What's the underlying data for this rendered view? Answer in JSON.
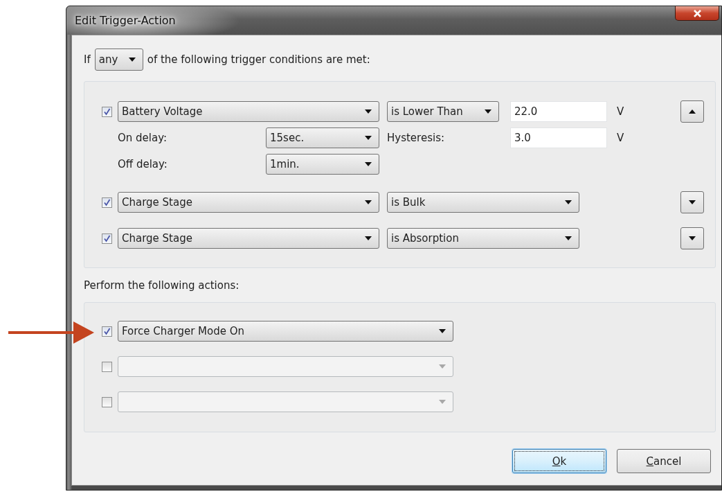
{
  "window": {
    "title": "Edit Trigger-Action"
  },
  "match_line": {
    "prefix": "If",
    "mode": "any",
    "suffix": "of the following trigger conditions are met:"
  },
  "conditions": [
    {
      "kind": "threshold",
      "checked": true,
      "source": "Battery Voltage",
      "operator": "is Lower Than",
      "value": "22.0",
      "unit": "V",
      "move_up": true,
      "on_delay_label": "On delay:",
      "on_delay": "15sec.",
      "hysteresis_label": "Hysteresis:",
      "hysteresis": "3.0",
      "hysteresis_unit": "V",
      "off_delay_label": "Off delay:",
      "off_delay": "1min."
    },
    {
      "kind": "state",
      "checked": true,
      "source": "Charge Stage",
      "operator": "is Bulk",
      "move_up": false
    },
    {
      "kind": "state",
      "checked": true,
      "source": "Charge Stage",
      "operator": "is Absorption",
      "move_up": false
    }
  ],
  "actions_label": "Perform the following actions:",
  "actions": [
    {
      "checked": true,
      "disabled": false,
      "action": "Force Charger Mode On"
    },
    {
      "checked": false,
      "disabled": true
    },
    {
      "checked": false,
      "disabled": true
    }
  ],
  "buttons": [
    {
      "label": "Ok",
      "focused": true
    },
    {
      "label": "Cancel",
      "focused": false
    }
  ]
}
